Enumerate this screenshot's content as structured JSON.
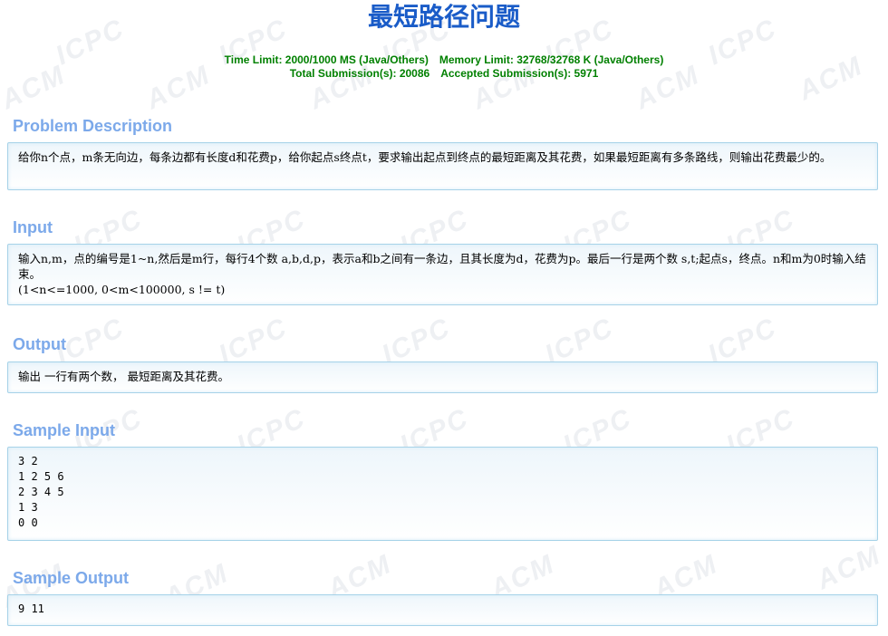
{
  "problem": {
    "title": "最短路径问题",
    "limits_line1_a": "Time Limit: 2000/1000 MS (Java/Others)",
    "limits_line1_b": "Memory Limit: 32768/32768 K (Java/Others)",
    "limits_line2_a": "Total Submission(s): 20086",
    "limits_line2_b": "Accepted Submission(s): 5971"
  },
  "sections": {
    "description": {
      "label": "Problem Description",
      "text": "给你n个点，m条无向边，每条边都有长度d和花费p，给你起点s终点t，要求输出起点到终点的最短距离及其花费，如果最短距离有多条路线，则输出花费最少的。"
    },
    "input": {
      "label": "Input",
      "line1": "输入n,m，点的编号是1~n,然后是m行，每行4个数 a,b,d,p，表示a和b之间有一条边，且其长度为d，花费为p。最后一行是两个数 s,t;起点s，终点。n和m为0时输入结束。",
      "line2": "(1<n<=1000, 0<m<100000, s != t)"
    },
    "output": {
      "label": "Output",
      "text": "输出 一行有两个数， 最短距离及其花费。"
    },
    "sample_input": {
      "label": "Sample Input",
      "text": "3 2\n1 2 5 6\n2 3 4 5\n1 3\n0 0"
    },
    "sample_output": {
      "label": "Sample Output",
      "text": "9 11"
    }
  }
}
